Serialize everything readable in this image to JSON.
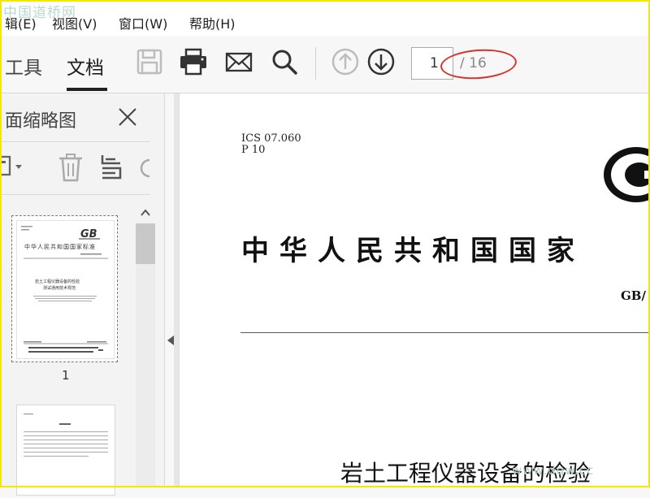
{
  "watermark": {
    "top": "中国道桥网",
    "bottom": "www.dqw.cc"
  },
  "menu": {
    "edit": "辑(E)",
    "view": "视图(V)",
    "window": "窗口(W)",
    "help": "帮助(H)"
  },
  "toolbar": {
    "tab_tools": "工具",
    "tab_document": "文档",
    "page_current": "1",
    "page_total": "/ 16",
    "icons": [
      "save-icon",
      "print-icon",
      "mail-icon",
      "search-icon",
      "arrow-up-icon",
      "arrow-down-icon"
    ]
  },
  "sidebar": {
    "title": "面缩略图",
    "pages": [
      {
        "label": "1"
      }
    ],
    "tools": [
      "options-icon",
      "delete-icon",
      "extract-icon",
      "rotate-icon"
    ]
  },
  "thumb1": {
    "gb": "GB",
    "heading": "中华人民共和国国家标准",
    "title1": "岩土工程仪器设备的检验",
    "title2": "测试通用技术规范"
  },
  "document": {
    "ics": "ICS  07.060",
    "p": "P  10",
    "national_title": "中华人民共和国国家",
    "gb_code": "GB/",
    "standard_title": "岩土工程仪器设备的检验"
  },
  "colors": {
    "annotation": "#d6332a",
    "frame": "#f2e800"
  }
}
